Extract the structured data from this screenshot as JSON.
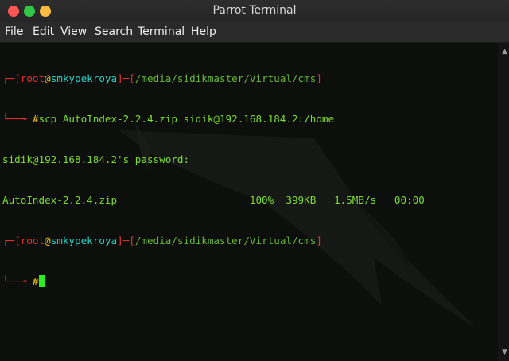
{
  "window": {
    "title": "Parrot Terminal"
  },
  "menu": {
    "items": [
      "File",
      "Edit",
      "View",
      "Search",
      "Terminal",
      "Help"
    ]
  },
  "terminal": {
    "prompt1": {
      "user": "root",
      "at": "@",
      "host": "smkypekroya",
      "path": "/media/sidikmaster/Virtual/cms",
      "command": "scp AutoIndex-2.2.4.zip sidik@192.168.184.2:/home"
    },
    "output_password": "sidik@192.168.184.2's password:",
    "transfer": {
      "file": "AutoIndex-2.2.4.zip",
      "percent": "100%",
      "size": "399KB",
      "rate": "1.5MB/s",
      "time": "00:00"
    },
    "prompt2": {
      "user": "root",
      "at": "@",
      "host": "smkypekroya",
      "path": "/media/sidikmaster/Virtual/cms"
    },
    "prompt_symbol": "#"
  },
  "colors": {
    "close": "#fc5753",
    "maximize": "#33c748",
    "minimize": "#fdbc40",
    "prompt_frame": "#e0322f",
    "host": "#27d1c4",
    "symbol": "#f2c11b",
    "text": "#7ddc30"
  }
}
